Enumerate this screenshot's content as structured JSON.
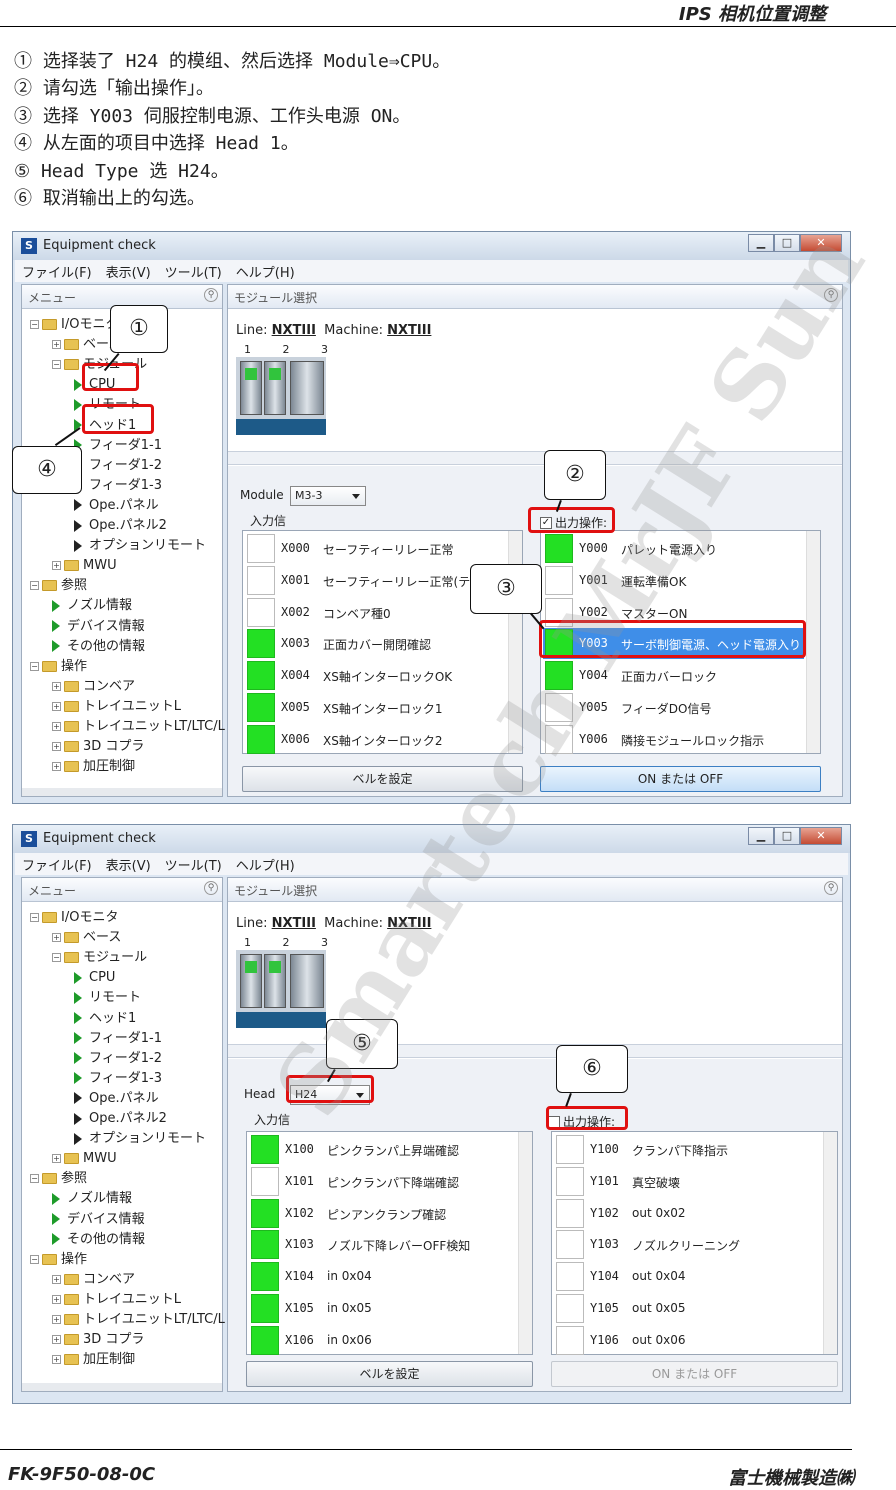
{
  "header": {
    "title": "IPS 相机位置调整"
  },
  "steps": [
    "① 选择装了 H24 的模组、然后选择 Module⇒CPU。",
    "② 请勾选「输出操作」。",
    "③ 选择 Y003 伺服控制电源、工作头电源 ON。",
    "④ 从左面的项目中选择 Head 1。",
    "⑤ Head Type 选 H24。",
    "⑥ 取消输出上的勾选。"
  ],
  "window": {
    "title": "Equipment check",
    "menus": [
      "ファイル(F)",
      "表示(V)",
      "ツール(T)",
      "ヘルプ(H)"
    ],
    "left_header": "メニュー",
    "right_header": "モジュール選択",
    "line_label": "Line:",
    "line_value": "NXTIII",
    "machine_label": "Machine:",
    "machine_value": "NXTIII",
    "module_nums": "1 2 3"
  },
  "tree": [
    {
      "label": "I/Oモニタ",
      "level": 0,
      "type": "folder"
    },
    {
      "label": "ベース",
      "level": 1,
      "type": "folder"
    },
    {
      "label": "モジュール",
      "level": 1,
      "type": "folder"
    },
    {
      "label": "CPU",
      "level": 2,
      "type": "item"
    },
    {
      "label": "リモート",
      "level": 2,
      "type": "item"
    },
    {
      "label": "ヘッド1",
      "level": 2,
      "type": "item"
    },
    {
      "label": "フィーダ1-1",
      "level": 2,
      "type": "item"
    },
    {
      "label": "フィーダ1-2",
      "level": 2,
      "type": "item"
    },
    {
      "label": "フィーダ1-3",
      "level": 2,
      "type": "item"
    },
    {
      "label": "Ope.パネル",
      "level": 2,
      "type": "item"
    },
    {
      "label": "Ope.パネル2",
      "level": 2,
      "type": "item"
    },
    {
      "label": "オプションリモート",
      "level": 2,
      "type": "item"
    },
    {
      "label": "MWU",
      "level": 1,
      "type": "folder"
    },
    {
      "label": "参照",
      "level": 0,
      "type": "folder"
    },
    {
      "label": "ノズル情報",
      "level": 1,
      "type": "item"
    },
    {
      "label": "デバイス情報",
      "level": 1,
      "type": "item"
    },
    {
      "label": "その他の情報",
      "level": 1,
      "type": "item"
    },
    {
      "label": "操作",
      "level": 0,
      "type": "folder"
    },
    {
      "label": "コンベア",
      "level": 1,
      "type": "folder"
    },
    {
      "label": "トレイユニットL",
      "level": 1,
      "type": "folder"
    },
    {
      "label": "トレイユニットLT/LTC/L",
      "level": 1,
      "type": "folder"
    },
    {
      "label": "3D コプラ",
      "level": 1,
      "type": "folder"
    },
    {
      "label": "加圧制御",
      "level": 1,
      "type": "folder"
    }
  ],
  "panel1": {
    "select_label": "Module",
    "select_value": "M3-3",
    "input_label": "入力信",
    "output_label": "出力操作:",
    "output_checked": true,
    "inputs": [
      {
        "code": "X000",
        "name": "セーフティーリレー正常",
        "on": false
      },
      {
        "code": "X001",
        "name": "セーフティーリレー正常(テ",
        "on": false
      },
      {
        "code": "X002",
        "name": "コンベア種0",
        "on": false
      },
      {
        "code": "X003",
        "name": "正面カバー開閉確認",
        "on": true
      },
      {
        "code": "X004",
        "name": "XS軸インターロックOK",
        "on": true
      },
      {
        "code": "X005",
        "name": "XS軸インターロック1",
        "on": true
      },
      {
        "code": "X006",
        "name": "XS軸インターロック2",
        "on": true
      }
    ],
    "outputs": [
      {
        "code": "Y000",
        "name": "パレット電源入り",
        "on": true
      },
      {
        "code": "Y001",
        "name": "運転準備OK",
        "on": false
      },
      {
        "code": "Y002",
        "name": "マスターON",
        "on": false
      },
      {
        "code": "Y003",
        "name": "サーボ制御電源、ヘッド電源入り",
        "on": true,
        "highlight": true
      },
      {
        "code": "Y004",
        "name": "正面カバーロック",
        "on": true
      },
      {
        "code": "Y005",
        "name": "フィーダDO信号",
        "on": false
      },
      {
        "code": "Y006",
        "name": "隣接モジュールロック指示",
        "on": false
      }
    ],
    "btn_left": "ベルを設定",
    "btn_right": "ON または OFF"
  },
  "panel2": {
    "select_label": "Head",
    "select_value": "H24",
    "input_label": "入力信",
    "output_label": "出力操作:",
    "output_checked": false,
    "inputs": [
      {
        "code": "X100",
        "name": "ピンクランパ上昇端確認",
        "on": true
      },
      {
        "code": "X101",
        "name": "ピンクランパ下降端確認",
        "on": false
      },
      {
        "code": "X102",
        "name": "ピンアンクランプ確認",
        "on": true
      },
      {
        "code": "X103",
        "name": "ノズル下降レバーOFF検知",
        "on": true
      },
      {
        "code": "X104",
        "name": "in 0x04",
        "on": true
      },
      {
        "code": "X105",
        "name": "in 0x05",
        "on": true
      },
      {
        "code": "X106",
        "name": "in 0x06",
        "on": true
      }
    ],
    "outputs": [
      {
        "code": "Y100",
        "name": "クランパ下降指示",
        "on": false
      },
      {
        "code": "Y101",
        "name": "真空破壊",
        "on": false
      },
      {
        "code": "Y102",
        "name": "out 0x02",
        "on": false
      },
      {
        "code": "Y103",
        "name": "ノズルクリーニング",
        "on": false
      },
      {
        "code": "Y104",
        "name": "out 0x04",
        "on": false
      },
      {
        "code": "Y105",
        "name": "out 0x05",
        "on": false
      },
      {
        "code": "Y106",
        "name": "out 0x06",
        "on": false
      }
    ],
    "btn_left": "ベルを設定",
    "btn_right": "ON または OFF"
  },
  "callouts": [
    "①",
    "②",
    "③",
    "④",
    "⑤",
    "⑥"
  ],
  "watermark": "Smartech MrJF Sun",
  "footer": {
    "left": "FK-9F50-08-0C",
    "right": "富士機械製造㈱"
  },
  "colors": {
    "on": "#23e023",
    "highlight": "#3f8ee8",
    "annotation": "#e01010"
  }
}
